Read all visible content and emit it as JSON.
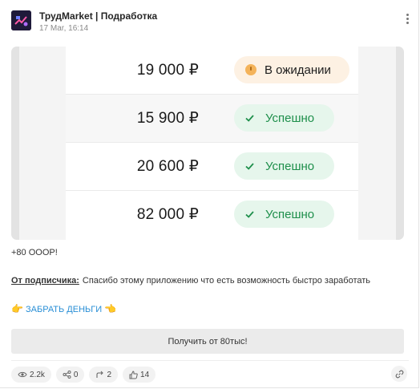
{
  "post": {
    "channel_name": "ТрудMarket | Подработка",
    "date": "17 Mar, 16:14"
  },
  "media": {
    "rows": [
      {
        "amount": "19 000 ₽",
        "status": "В ожидании",
        "status_kind": "pending"
      },
      {
        "amount": "15 900 ₽",
        "status": "Успешно",
        "status_kind": "success"
      },
      {
        "amount": "20 600 ₽",
        "status": "Успешно",
        "status_kind": "success"
      },
      {
        "amount": "82 000 ₽",
        "status": "Успешно",
        "status_kind": "success"
      }
    ]
  },
  "text": {
    "line1": "+80 OOOР!",
    "subscriber_label": "От подписчика:",
    "subscriber_text": "Спасибо этому приложению что есть возможность быстро заработать",
    "cta_link": "ЗАБРАТЬ ДЕНЬГИ"
  },
  "button": {
    "label": "Получить от 80тыс!"
  },
  "stats": {
    "views": "2.2k",
    "shares": "0",
    "reposts": "2",
    "likes": "14"
  },
  "icons": {
    "views": "eye-icon",
    "shares": "share-icon",
    "reposts": "repost-icon",
    "likes": "thumbs-up-icon",
    "link": "link-icon",
    "menu": "kebab-menu-icon",
    "status_pending": "clock-icon",
    "status_success": "check-icon",
    "hand_left": "pointing-right-hand-icon",
    "hand_right": "pointing-left-hand-icon"
  },
  "colors": {
    "success_text": "#1e8f4b",
    "success_bg": "#e6f6ec",
    "pending_bg": "#fdf1e3",
    "pending_dot": "#f4b35a",
    "link": "#2a8fd6"
  }
}
